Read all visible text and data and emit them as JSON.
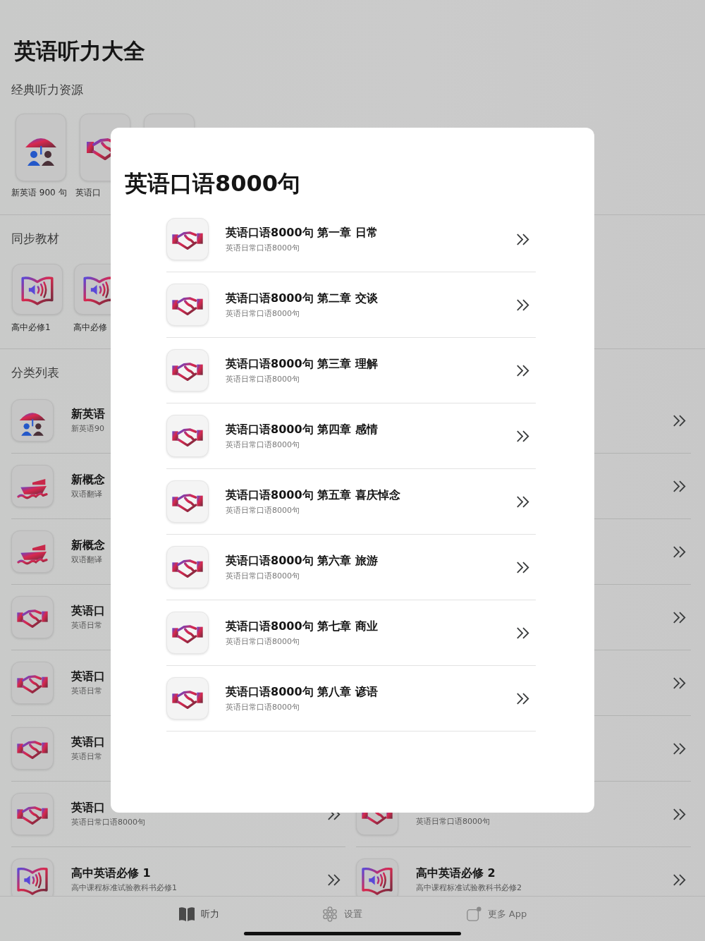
{
  "app_title": "英语听力大全",
  "classic": {
    "heading": "经典听力资源",
    "cards": [
      {
        "kind": "umbrella",
        "label": "新英语 900 句"
      },
      {
        "kind": "handshake",
        "label": "英语口"
      },
      {
        "kind": "blank"
      }
    ]
  },
  "textbooks": {
    "heading": "同步教材",
    "cards": [
      {
        "kind": "book",
        "label": "高中必修1"
      },
      {
        "kind": "book",
        "label": "高中必修"
      }
    ]
  },
  "category": {
    "heading": "分类列表",
    "rows": [
      {
        "left": {
          "kind": "umbrella",
          "title": "新英语",
          "subtitle": "新英语90",
          "chevron": false
        },
        "right": {
          "kind": "none",
          "chevron": true
        }
      },
      {
        "left": {
          "kind": "ship",
          "title": "新概念",
          "subtitle": "双语翻译",
          "chevron": false
        },
        "right": {
          "kind": "none",
          "chevron": true
        }
      },
      {
        "left": {
          "kind": "ship",
          "title": "新概念",
          "subtitle": "双语翻译",
          "chevron": false
        },
        "right": {
          "kind": "none",
          "chevron": true
        }
      },
      {
        "left": {
          "kind": "handshake",
          "title": "英语口",
          "subtitle": "英语日常",
          "chevron": false
        },
        "right": {
          "kind": "none",
          "chevron": true
        }
      },
      {
        "left": {
          "kind": "handshake",
          "title": "英语口",
          "subtitle": "英语日常",
          "chevron": false
        },
        "right": {
          "kind": "none",
          "chevron": true
        }
      },
      {
        "left": {
          "kind": "handshake",
          "title": "英语口",
          "subtitle": "英语日常",
          "chevron": false
        },
        "right": {
          "kind": "none",
          "chevron": true
        }
      },
      {
        "left": {
          "kind": "handshake",
          "title": "英语口",
          "subtitle": "英语日常口语8000句",
          "chevron": true
        },
        "right": {
          "kind": "handshake",
          "subtitle": "英语日常口语8000句",
          "chevron": true
        }
      },
      {
        "left": {
          "kind": "book",
          "title": "高中英语必修 1",
          "subtitle": "高中课程标准试验教科书必修1",
          "chevron": true
        },
        "right": {
          "kind": "book",
          "title": "高中英语必修 2",
          "subtitle": "高中课程标准试验教科书必修2",
          "chevron": true
        }
      }
    ]
  },
  "modal": {
    "title": "英语口语8000句",
    "items": [
      {
        "kind": "handshake",
        "title": "英语口语8000句 第一章 日常",
        "subtitle": "英语日常口语8000句"
      },
      {
        "kind": "handshake",
        "title": "英语口语8000句 第二章 交谈",
        "subtitle": "英语日常口语8000句"
      },
      {
        "kind": "handshake",
        "title": "英语口语8000句 第三章 理解",
        "subtitle": "英语日常口语8000句"
      },
      {
        "kind": "handshake",
        "title": "英语口语8000句 第四章 感情",
        "subtitle": "英语日常口语8000句"
      },
      {
        "kind": "handshake",
        "title": "英语口语8000句 第五章 喜庆悼念",
        "subtitle": "英语日常口语8000句"
      },
      {
        "kind": "handshake",
        "title": "英语口语8000句 第六章 旅游",
        "subtitle": "英语日常口语8000句"
      },
      {
        "kind": "handshake",
        "title": "英语口语8000句 第七章 商业",
        "subtitle": "英语日常口语8000句"
      },
      {
        "kind": "handshake",
        "title": "英语口语8000句 第八章 谚语",
        "subtitle": "英语日常口语8000句"
      }
    ]
  },
  "tabs": [
    {
      "kind": "book",
      "label": "听力",
      "selected": true
    },
    {
      "kind": "flower",
      "label": "设置",
      "selected": false
    },
    {
      "kind": "apps",
      "label": "更多 App",
      "selected": false
    }
  ]
}
